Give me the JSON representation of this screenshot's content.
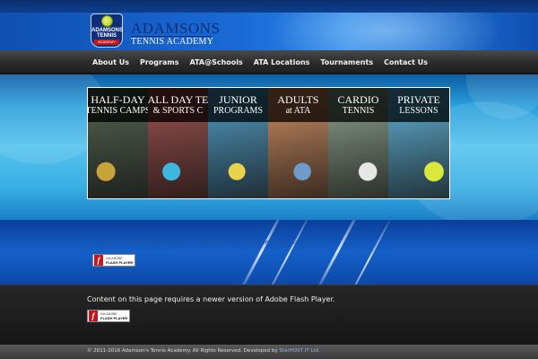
{
  "brand": {
    "badge_line1": "ADAMSONS",
    "badge_line2": "TENNIS",
    "badge_ribbon": "ACADEMY",
    "name_line1": "ADAMSONS",
    "name_line2": "TENNIS ACADEMY"
  },
  "nav": {
    "items": [
      "About Us",
      "Programs",
      "ATA@Schools",
      "ATA Locations",
      "Tournaments",
      "Contact Us"
    ]
  },
  "banner": {
    "panels": [
      {
        "line1": "HALF-DAY",
        "line2": "TENNIS CAMPS",
        "bg": "#3b4d38",
        "accent": "#c8a33a"
      },
      {
        "line1": "ALL DAY TE",
        "line2": "& SPORTS C",
        "bg": "#8b3a37",
        "accent": "#3db7e0"
      },
      {
        "line1": "JUNIOR",
        "line2": "PROGRAMS",
        "bg": "#3a8bb5",
        "accent": "#e9d34a"
      },
      {
        "line1": "ADULTS",
        "line2": "at ATA",
        "bg": "#c07a4a",
        "accent": "#6e9bc9"
      },
      {
        "line1": "CARDIO",
        "line2": "TENNIS",
        "bg": "#7a8f7a",
        "accent": "#e6e6e6"
      },
      {
        "line1": "PRIVATE",
        "line2": "LESSONS",
        "bg": "#4aa2c9",
        "accent": "#d9e83a"
      }
    ]
  },
  "flash": {
    "message": "Content on this page requires a newer version of Adobe Flash Player.",
    "badge_get": "Get ADOBE",
    "badge_product": "FLASH PLAYER",
    "badge_icon": "f"
  },
  "footer": {
    "text": "© 2011-2016 Adamson's Tennis Academy. All Rights Reserved. Developed by",
    "developer": "StarHOST IT Ltd."
  },
  "colors": {
    "header_blue": "#1a6ad6",
    "nav_dark": "#2c2c2c",
    "banner_blue": "#55c3ec",
    "flash_red": "#c4161c"
  }
}
